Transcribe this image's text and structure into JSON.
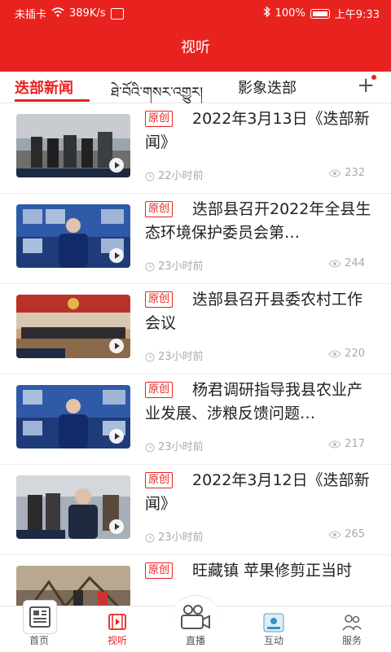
{
  "status_bar": {
    "carrier": "未插卡",
    "speed": "389K/s",
    "battery": "100%",
    "time": "上午9:33"
  },
  "header": {
    "title": "视听"
  },
  "tabs": [
    {
      "label": "迭部新闻",
      "active": true
    },
    {
      "label": "ཐེ་བོའི་གསར་འགྱུར།",
      "active": false
    },
    {
      "label": "影象迭部",
      "active": false
    }
  ],
  "colors": {
    "accent": "#e8231f"
  },
  "news": [
    {
      "badge": "原创",
      "title": "2022年3月13日《迭部新闻》",
      "time": "22小时前",
      "views": "232"
    },
    {
      "badge": "原创",
      "title": "迭部县召开2022年全县生态环境保护委员会第…",
      "time": "23小时前",
      "views": "244"
    },
    {
      "badge": "原创",
      "title": "迭部县召开县委农村工作会议",
      "time": "23小时前",
      "views": "220"
    },
    {
      "badge": "原创",
      "title": "杨君调研指导我县农业产业发展、涉粮反馈问题…",
      "time": "23小时前",
      "views": "217"
    },
    {
      "badge": "原创",
      "title": "2022年3月12日《迭部新闻》",
      "time": "23小时前",
      "views": "265"
    },
    {
      "badge": "原创",
      "title": "旺藏镇 苹果修剪正当时",
      "time": "",
      "views": ""
    }
  ],
  "bottom_nav": [
    {
      "label": "首页",
      "icon": "newspaper-icon"
    },
    {
      "label": "视听",
      "icon": "film-icon",
      "active": true
    },
    {
      "label": "直播",
      "icon": "video-camera-icon"
    },
    {
      "label": "互动",
      "icon": "app-tile-icon"
    },
    {
      "label": "服务",
      "icon": "people-icon"
    }
  ]
}
